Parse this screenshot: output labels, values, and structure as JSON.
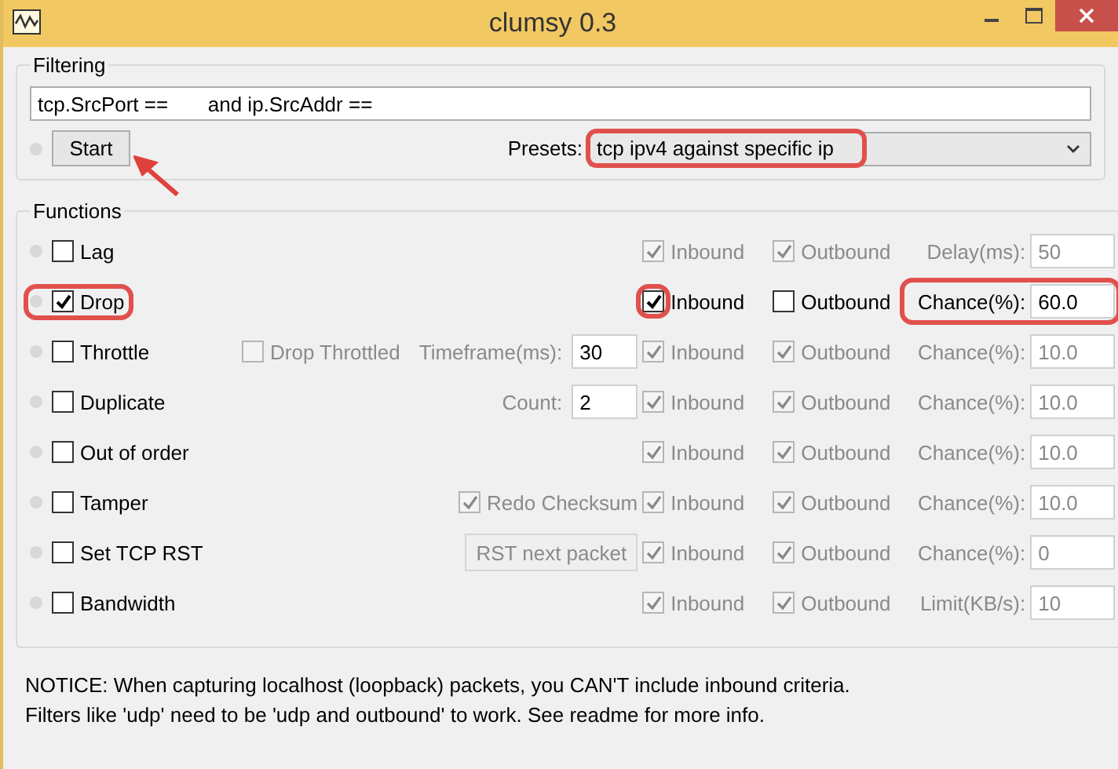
{
  "window": {
    "title": "clumsy 0.3"
  },
  "filtering": {
    "title": "Filtering",
    "filter": "tcp.SrcPort ==       and ip.SrcAddr ==",
    "start_button": {
      "label": "Start",
      "pointed": true
    },
    "presets": {
      "label": "Presets:",
      "value": "tcp ipv4 against specific ip",
      "highlighted": true
    }
  },
  "functions": {
    "title": "Functions",
    "items": [
      {
        "name": "Lag",
        "checked": false,
        "highlighted": false,
        "inbound": {
          "label": "Inbound",
          "checked": true,
          "disabled": true,
          "highlighted": false
        },
        "outbound": {
          "label": "Outbound",
          "checked": true,
          "disabled": true
        },
        "param": {
          "label": "Delay(ms):",
          "value": "50",
          "disabled": true,
          "highlighted": false
        }
      },
      {
        "name": "Drop",
        "checked": true,
        "highlighted": true,
        "inbound": {
          "label": "Inbound",
          "checked": true,
          "disabled": false,
          "highlighted": true
        },
        "outbound": {
          "label": "Outbound",
          "checked": false,
          "disabled": false
        },
        "param": {
          "label": "Chance(%):",
          "value": "60.0",
          "disabled": false,
          "highlighted": true
        }
      },
      {
        "name": "Throttle",
        "checked": false,
        "highlighted": false,
        "extras": [
          {
            "kind": "checkbox",
            "label": "Drop Throttled",
            "checked": false,
            "disabled": true
          },
          {
            "kind": "field",
            "label": "Timeframe(ms):",
            "value": "30"
          }
        ],
        "inbound": {
          "label": "Inbound",
          "checked": true,
          "disabled": true,
          "highlighted": false
        },
        "outbound": {
          "label": "Outbound",
          "checked": true,
          "disabled": true
        },
        "param": {
          "label": "Chance(%):",
          "value": "10.0",
          "disabled": true,
          "highlighted": false
        }
      },
      {
        "name": "Duplicate",
        "checked": false,
        "highlighted": false,
        "extras": [
          {
            "kind": "field",
            "label": "Count:",
            "value": "2"
          }
        ],
        "inbound": {
          "label": "Inbound",
          "checked": true,
          "disabled": true,
          "highlighted": false
        },
        "outbound": {
          "label": "Outbound",
          "checked": true,
          "disabled": true
        },
        "param": {
          "label": "Chance(%):",
          "value": "10.0",
          "disabled": true,
          "highlighted": false
        }
      },
      {
        "name": "Out of order",
        "checked": false,
        "highlighted": false,
        "inbound": {
          "label": "Inbound",
          "checked": true,
          "disabled": true,
          "highlighted": false
        },
        "outbound": {
          "label": "Outbound",
          "checked": true,
          "disabled": true
        },
        "param": {
          "label": "Chance(%):",
          "value": "10.0",
          "disabled": true,
          "highlighted": false
        }
      },
      {
        "name": "Tamper",
        "checked": false,
        "highlighted": false,
        "extras": [
          {
            "kind": "checkbox",
            "label": "Redo Checksum",
            "checked": true,
            "disabled": true
          }
        ],
        "inbound": {
          "label": "Inbound",
          "checked": true,
          "disabled": true,
          "highlighted": false
        },
        "outbound": {
          "label": "Outbound",
          "checked": true,
          "disabled": true
        },
        "param": {
          "label": "Chance(%):",
          "value": "10.0",
          "disabled": true,
          "highlighted": false
        }
      },
      {
        "name": "Set TCP RST",
        "checked": false,
        "highlighted": false,
        "extras": [
          {
            "kind": "button",
            "label": "RST next packet",
            "disabled": true
          }
        ],
        "inbound": {
          "label": "Inbound",
          "checked": true,
          "disabled": true,
          "highlighted": false
        },
        "outbound": {
          "label": "Outbound",
          "checked": true,
          "disabled": true
        },
        "param": {
          "label": "Chance(%):",
          "value": "0",
          "disabled": true,
          "highlighted": false
        }
      },
      {
        "name": "Bandwidth",
        "checked": false,
        "highlighted": false,
        "inbound": {
          "label": "Inbound",
          "checked": true,
          "disabled": true,
          "highlighted": false
        },
        "outbound": {
          "label": "Outbound",
          "checked": true,
          "disabled": true
        },
        "param": {
          "label": "Limit(KB/s):",
          "value": "10",
          "disabled": true,
          "highlighted": false
        }
      }
    ]
  },
  "notice": [
    "NOTICE: When capturing localhost (loopback) packets, you CAN'T include inbound criteria.",
    "Filters like 'udp' need to be 'udp and outbound' to work. See readme for more info."
  ]
}
